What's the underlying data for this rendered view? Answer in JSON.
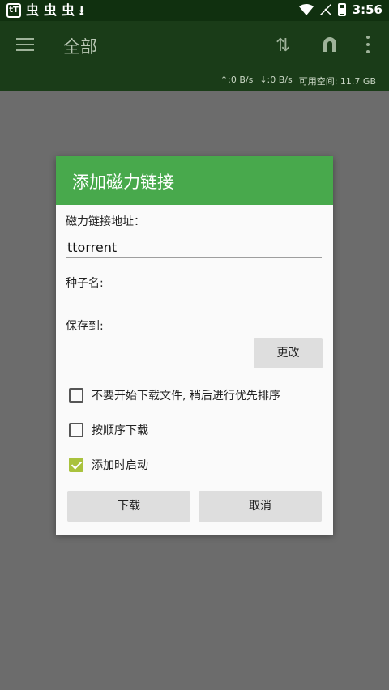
{
  "status_bar": {
    "app_icons": [
      "app-badge-icon",
      "bug-icon",
      "bug-icon",
      "bug-icon",
      "download-icon"
    ],
    "time": "3:56",
    "right_icons": [
      "wifi-icon",
      "no-signal-icon",
      "battery-icon"
    ]
  },
  "app_bar": {
    "title": "全部",
    "upload_speed": "↑:0 B/s",
    "download_speed": "↓:0 B/s",
    "free_space": "可用空间: 11.7 GB",
    "icons": [
      "menu-icon",
      "sort-icon",
      "magnet-icon",
      "more-vert-icon"
    ]
  },
  "dialog": {
    "title": "添加磁力链接",
    "magnet_label": "磁力链接地址：",
    "magnet_value": "ttorrent",
    "seed_name_label": "种子名:",
    "save_to_label": "保存到:",
    "change_button": "更改",
    "options": [
      {
        "label": "不要开始下载文件, 稍后进行优先排序",
        "checked": false
      },
      {
        "label": "按顺序下载",
        "checked": false
      },
      {
        "label": "添加时启动",
        "checked": true
      }
    ],
    "download_button": "下载",
    "cancel_button": "取消"
  },
  "colors": {
    "status_bar": "#10300f",
    "app_bar": "#1a3c18",
    "dialog_header": "#48a94c",
    "checkbox_checked": "#a9c23d",
    "overlay": "#6c6c6c"
  }
}
